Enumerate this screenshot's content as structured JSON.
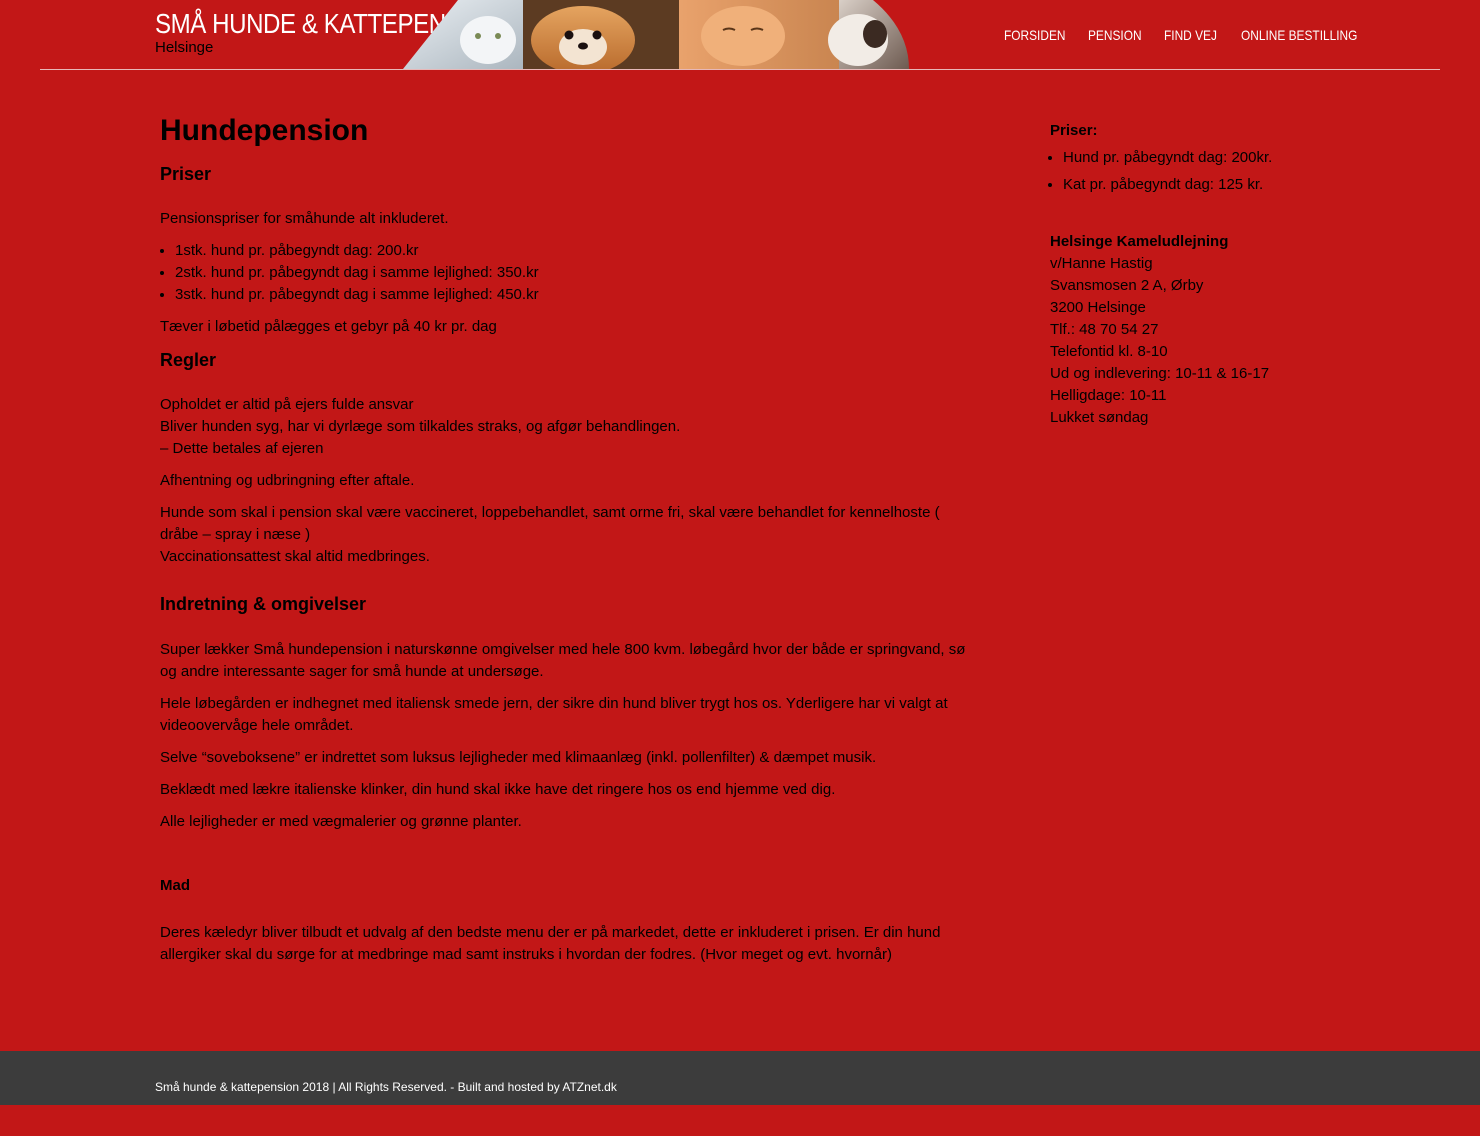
{
  "header": {
    "site_title": "SMÅ HUNDE & KATTEPENSION",
    "site_subtitle": "Helsinge",
    "nav": [
      "FORSIDEN",
      "PENSION",
      "FIND VEJ",
      "ONLINE BESTILLING"
    ]
  },
  "main": {
    "title": "Hundepension",
    "priser_heading": "Priser",
    "priser_intro": "Pensionspriser for småhunde alt inkluderet.",
    "priser_items": [
      "1stk. hund pr. påbegyndt dag: 200.kr",
      "2stk. hund pr. påbegyndt dag i samme lejlighed: 350.kr",
      "3stk. hund pr. påbegyndt dag i samme lejlighed: 450.kr"
    ],
    "priser_note": "Tæver i løbetid pålægges et gebyr på 40 kr pr. dag",
    "regler_heading": "Regler",
    "regler_lines": [
      "Opholdet er altid på ejers fulde ansvar",
      "Bliver hunden syg, har vi dyrlæge som tilkaldes straks, og afgør behandlingen.",
      "– Dette betales af ejeren"
    ],
    "regler_p2": "Afhentning og udbringning efter aftale.",
    "regler_p3": "Hunde som skal i pension skal være vaccineret, loppebehandlet, samt orme fri, skal være behandlet for kennelhoste ( dråbe – spray i næse )",
    "regler_p3b": "Vaccinationsattest skal altid medbringes.",
    "indretning_heading": "Indretning & omgivelser",
    "indretning_p1": "Super lækker Små hundepension i naturskønne omgivelser med hele 800 kvm. løbegård hvor der både er springvand, sø og andre interessante sager for små hunde at undersøge.",
    "indretning_p2": "Hele løbegården er indhegnet med italiensk smede jern, der sikre din hund bliver trygt hos os. Yderligere har vi valgt at videoovervåge hele området.",
    "indretning_p3": "Selve “soveboksene” er indrettet som luksus lejligheder med klimaanlæg (inkl. pollenfilter) & dæmpet musik.",
    "indretning_p4": "Beklædt med lækre italienske klinker, din hund skal ikke have det ringere hos os end hjemme ved dig.",
    "indretning_p5": "Alle lejligheder er med vægmalerier og grønne planter.",
    "mad_heading": "Mad",
    "mad_p": "Deres kæledyr bliver tilbudt et udvalg af den bedste menu der er på markedet, dette er inkluderet i prisen. Er din hund allergiker skal du sørge for at medbringe mad samt instruks i hvordan der fodres. (Hvor meget og evt. hvornår)"
  },
  "sidebar": {
    "priser_label": "Priser:",
    "priser_items": [
      "Hund pr. påbegyndt dag: 200kr.",
      "Kat pr. påbegyndt dag: 125 kr."
    ],
    "contact_name": "Helsinge Kameludlejning",
    "contact_lines": [
      "v/Hanne Hastig",
      "Svansmosen 2 A, Ørby",
      "3200 Helsinge",
      "Tlf.: 48 70 54 27",
      "Telefontid kl. 8-10",
      "Ud og indlevering: 10-11 & 16-17",
      "Helligdage: 10-11",
      "Lukket søndag"
    ]
  },
  "footer": {
    "text": "Små hunde & kattepension 2018 | All Rights Reserved. - Built and hosted by ATZnet.dk"
  },
  "colors": {
    "background": "#c21717",
    "footer": "#3c3c3c"
  },
  "banner_image": "pets-banner (white cat, pomeranian dog, ginger cat)"
}
